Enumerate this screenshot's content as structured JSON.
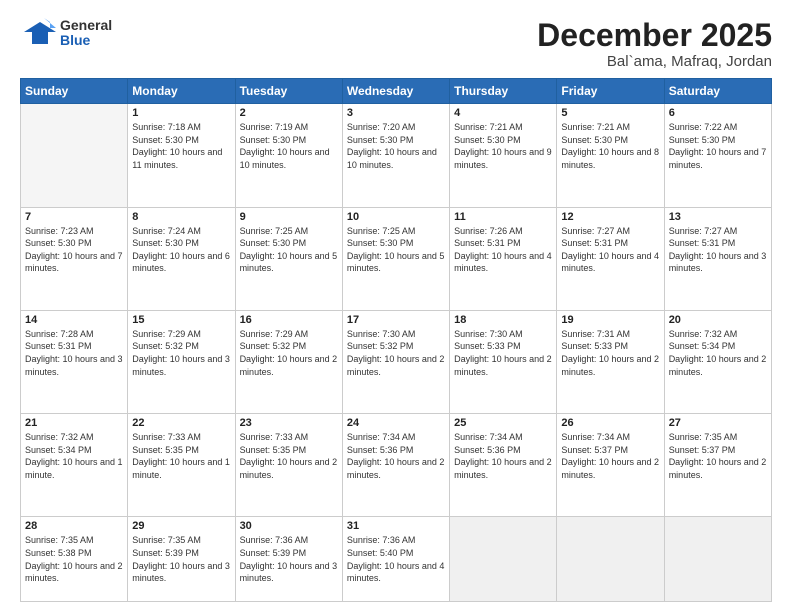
{
  "header": {
    "logo": {
      "general": "General",
      "blue": "Blue"
    },
    "month": "December 2025",
    "location": "Bal`ama, Mafraq, Jordan"
  },
  "weekdays": [
    "Sunday",
    "Monday",
    "Tuesday",
    "Wednesday",
    "Thursday",
    "Friday",
    "Saturday"
  ],
  "weeks": [
    [
      {
        "day": "",
        "empty": true
      },
      {
        "day": "1",
        "sunrise": "7:18 AM",
        "sunset": "5:30 PM",
        "daylight": "10 hours and 11 minutes."
      },
      {
        "day": "2",
        "sunrise": "7:19 AM",
        "sunset": "5:30 PM",
        "daylight": "10 hours and 10 minutes."
      },
      {
        "day": "3",
        "sunrise": "7:20 AM",
        "sunset": "5:30 PM",
        "daylight": "10 hours and 10 minutes."
      },
      {
        "day": "4",
        "sunrise": "7:21 AM",
        "sunset": "5:30 PM",
        "daylight": "10 hours and 9 minutes."
      },
      {
        "day": "5",
        "sunrise": "7:21 AM",
        "sunset": "5:30 PM",
        "daylight": "10 hours and 8 minutes."
      },
      {
        "day": "6",
        "sunrise": "7:22 AM",
        "sunset": "5:30 PM",
        "daylight": "10 hours and 7 minutes."
      }
    ],
    [
      {
        "day": "7",
        "sunrise": "7:23 AM",
        "sunset": "5:30 PM",
        "daylight": "10 hours and 7 minutes."
      },
      {
        "day": "8",
        "sunrise": "7:24 AM",
        "sunset": "5:30 PM",
        "daylight": "10 hours and 6 minutes."
      },
      {
        "day": "9",
        "sunrise": "7:25 AM",
        "sunset": "5:30 PM",
        "daylight": "10 hours and 5 minutes."
      },
      {
        "day": "10",
        "sunrise": "7:25 AM",
        "sunset": "5:30 PM",
        "daylight": "10 hours and 5 minutes."
      },
      {
        "day": "11",
        "sunrise": "7:26 AM",
        "sunset": "5:31 PM",
        "daylight": "10 hours and 4 minutes."
      },
      {
        "day": "12",
        "sunrise": "7:27 AM",
        "sunset": "5:31 PM",
        "daylight": "10 hours and 4 minutes."
      },
      {
        "day": "13",
        "sunrise": "7:27 AM",
        "sunset": "5:31 PM",
        "daylight": "10 hours and 3 minutes."
      }
    ],
    [
      {
        "day": "14",
        "sunrise": "7:28 AM",
        "sunset": "5:31 PM",
        "daylight": "10 hours and 3 minutes."
      },
      {
        "day": "15",
        "sunrise": "7:29 AM",
        "sunset": "5:32 PM",
        "daylight": "10 hours and 3 minutes."
      },
      {
        "day": "16",
        "sunrise": "7:29 AM",
        "sunset": "5:32 PM",
        "daylight": "10 hours and 2 minutes."
      },
      {
        "day": "17",
        "sunrise": "7:30 AM",
        "sunset": "5:32 PM",
        "daylight": "10 hours and 2 minutes."
      },
      {
        "day": "18",
        "sunrise": "7:30 AM",
        "sunset": "5:33 PM",
        "daylight": "10 hours and 2 minutes."
      },
      {
        "day": "19",
        "sunrise": "7:31 AM",
        "sunset": "5:33 PM",
        "daylight": "10 hours and 2 minutes."
      },
      {
        "day": "20",
        "sunrise": "7:32 AM",
        "sunset": "5:34 PM",
        "daylight": "10 hours and 2 minutes."
      }
    ],
    [
      {
        "day": "21",
        "sunrise": "7:32 AM",
        "sunset": "5:34 PM",
        "daylight": "10 hours and 1 minute."
      },
      {
        "day": "22",
        "sunrise": "7:33 AM",
        "sunset": "5:35 PM",
        "daylight": "10 hours and 1 minute."
      },
      {
        "day": "23",
        "sunrise": "7:33 AM",
        "sunset": "5:35 PM",
        "daylight": "10 hours and 2 minutes."
      },
      {
        "day": "24",
        "sunrise": "7:34 AM",
        "sunset": "5:36 PM",
        "daylight": "10 hours and 2 minutes."
      },
      {
        "day": "25",
        "sunrise": "7:34 AM",
        "sunset": "5:36 PM",
        "daylight": "10 hours and 2 minutes."
      },
      {
        "day": "26",
        "sunrise": "7:34 AM",
        "sunset": "5:37 PM",
        "daylight": "10 hours and 2 minutes."
      },
      {
        "day": "27",
        "sunrise": "7:35 AM",
        "sunset": "5:37 PM",
        "daylight": "10 hours and 2 minutes."
      }
    ],
    [
      {
        "day": "28",
        "sunrise": "7:35 AM",
        "sunset": "5:38 PM",
        "daylight": "10 hours and 2 minutes."
      },
      {
        "day": "29",
        "sunrise": "7:35 AM",
        "sunset": "5:39 PM",
        "daylight": "10 hours and 3 minutes."
      },
      {
        "day": "30",
        "sunrise": "7:36 AM",
        "sunset": "5:39 PM",
        "daylight": "10 hours and 3 minutes."
      },
      {
        "day": "31",
        "sunrise": "7:36 AM",
        "sunset": "5:40 PM",
        "daylight": "10 hours and 4 minutes."
      },
      {
        "day": "",
        "empty": true
      },
      {
        "day": "",
        "empty": true
      },
      {
        "day": "",
        "empty": true
      }
    ]
  ],
  "labels": {
    "sunrise": "Sunrise:",
    "sunset": "Sunset:",
    "daylight": "Daylight:"
  }
}
